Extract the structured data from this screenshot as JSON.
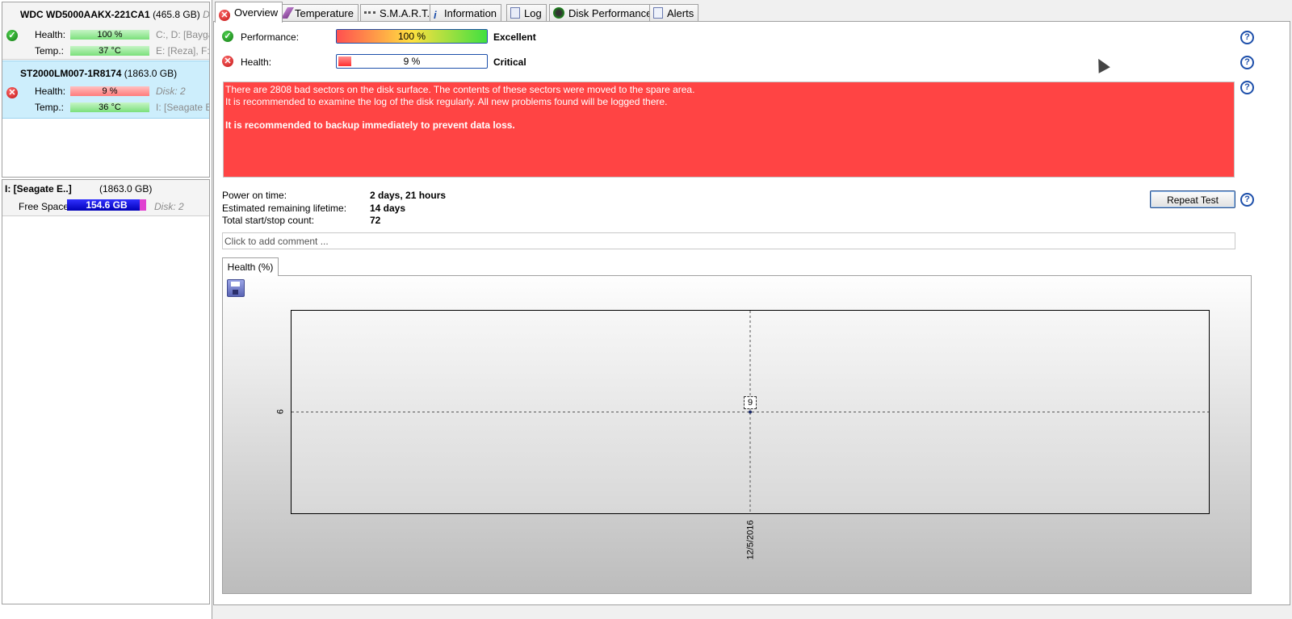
{
  "disks": [
    {
      "name": "WDC WD5000AAKX-221CA1",
      "size": "(465.8 GB)",
      "side": "Dis",
      "health_label": "Health:",
      "health_value": "100 %",
      "health_level": 100,
      "health_info": "C:, D: [Baygar",
      "temp_label": "Temp.:",
      "temp_value": "37 °C",
      "temp_info": "E: [Reza], F: [H",
      "status": "ok"
    },
    {
      "name": "ST2000LM007-1R8174",
      "size": "(1863.0 GB)",
      "side": "",
      "health_label": "Health:",
      "health_value": "9 %",
      "health_level": 9,
      "health_info": "Disk: 2",
      "temp_label": "Temp.:",
      "temp_value": "36 °C",
      "temp_info": "I: [Seagate Exp",
      "status": "error"
    }
  ],
  "volume": {
    "name": "I: [Seagate E..]",
    "size": "(1863.0 GB)",
    "label": "Free Space",
    "value": "154.6 GB",
    "info": "Disk: 2",
    "used_fraction": 0.92
  },
  "tabs": [
    {
      "label": "Overview",
      "icon": "error-icon"
    },
    {
      "label": "Temperature",
      "icon": "thermometer-icon"
    },
    {
      "label": "S.M.A.R.T.",
      "icon": "smart-icon"
    },
    {
      "label": "Information",
      "icon": "info-icon"
    },
    {
      "label": "Log",
      "icon": "log-icon"
    },
    {
      "label": "Disk Performance",
      "icon": "speedometer-icon"
    },
    {
      "label": "Alerts",
      "icon": "alerts-icon"
    }
  ],
  "overview": {
    "performance": {
      "label": "Performance:",
      "value": "100 %",
      "level": 100,
      "rating": "Excellent"
    },
    "health": {
      "label": "Health:",
      "value": "9 %",
      "level": 9,
      "rating": "Critical"
    },
    "message": {
      "line1": "There are 2808 bad sectors on the disk surface. The contents of these sectors were moved to the spare area.",
      "line2": "It is recommended to examine the log of the disk regularly. All new problems found will be logged there.",
      "line3": "It is recommended to backup immediately to prevent data loss."
    },
    "power_on_label": "Power on time:",
    "power_on_value": "2 days, 21 hours",
    "lifetime_label": "Estimated remaining lifetime:",
    "lifetime_value": "14 days",
    "startstop_label": "Total start/stop count:",
    "startstop_value": "72",
    "repeat_button": "Repeat Test",
    "comment_placeholder": "Click to add comment ..."
  },
  "chart_tab": "Health (%)",
  "chart_data": {
    "type": "line",
    "x": [
      "12/5/2016"
    ],
    "series": [
      {
        "values": [
          9
        ]
      }
    ],
    "y_tick": "9",
    "x_tick": "12/5/2016",
    "point_label": "9",
    "grid": true
  },
  "colors": {
    "error": "#ff4444",
    "accent": "#1d4faa",
    "ok": "#137a13"
  }
}
